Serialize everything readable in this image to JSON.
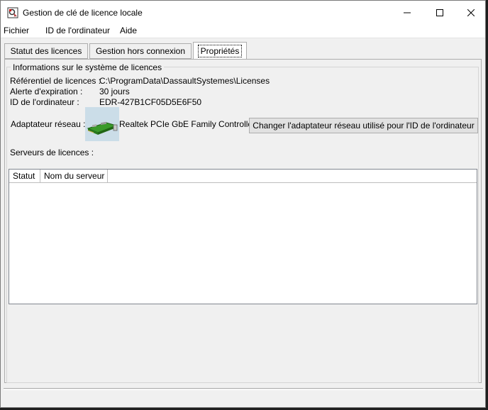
{
  "window": {
    "title": "Gestion de clé de licence locale"
  },
  "menu": {
    "items": [
      "Fichier",
      "ID de l'ordinateur",
      "Aide"
    ]
  },
  "tabs": [
    {
      "label": "Statut des licences",
      "active": false
    },
    {
      "label": "Gestion hors connexion",
      "active": false
    },
    {
      "label": "Propriétés",
      "active": true
    }
  ],
  "properties": {
    "group_title": "Informations sur le système de licences",
    "repository_label": "Référentiel de licences :",
    "repository_value": "C:\\ProgramData\\DassaultSystemes\\Licenses",
    "expiration_label": "Alerte d'expiration :",
    "expiration_value": "30 jours",
    "computer_id_label": "ID de l'ordinateur :",
    "computer_id_value": "EDR-427B1CF05D5E6F50",
    "adapter_label": "Adaptateur réseau :",
    "adapter_icon": "network-card-icon",
    "adapter_value": "Realtek PCIe GbE Family Controller",
    "change_adapter_button": "Changer l'adaptateur réseau utilisé pour l'ID de l'ordinateur",
    "servers_label": "Serveurs de licences :",
    "servers_columns": [
      "Statut",
      "Nom du serveur"
    ],
    "servers_rows": []
  }
}
